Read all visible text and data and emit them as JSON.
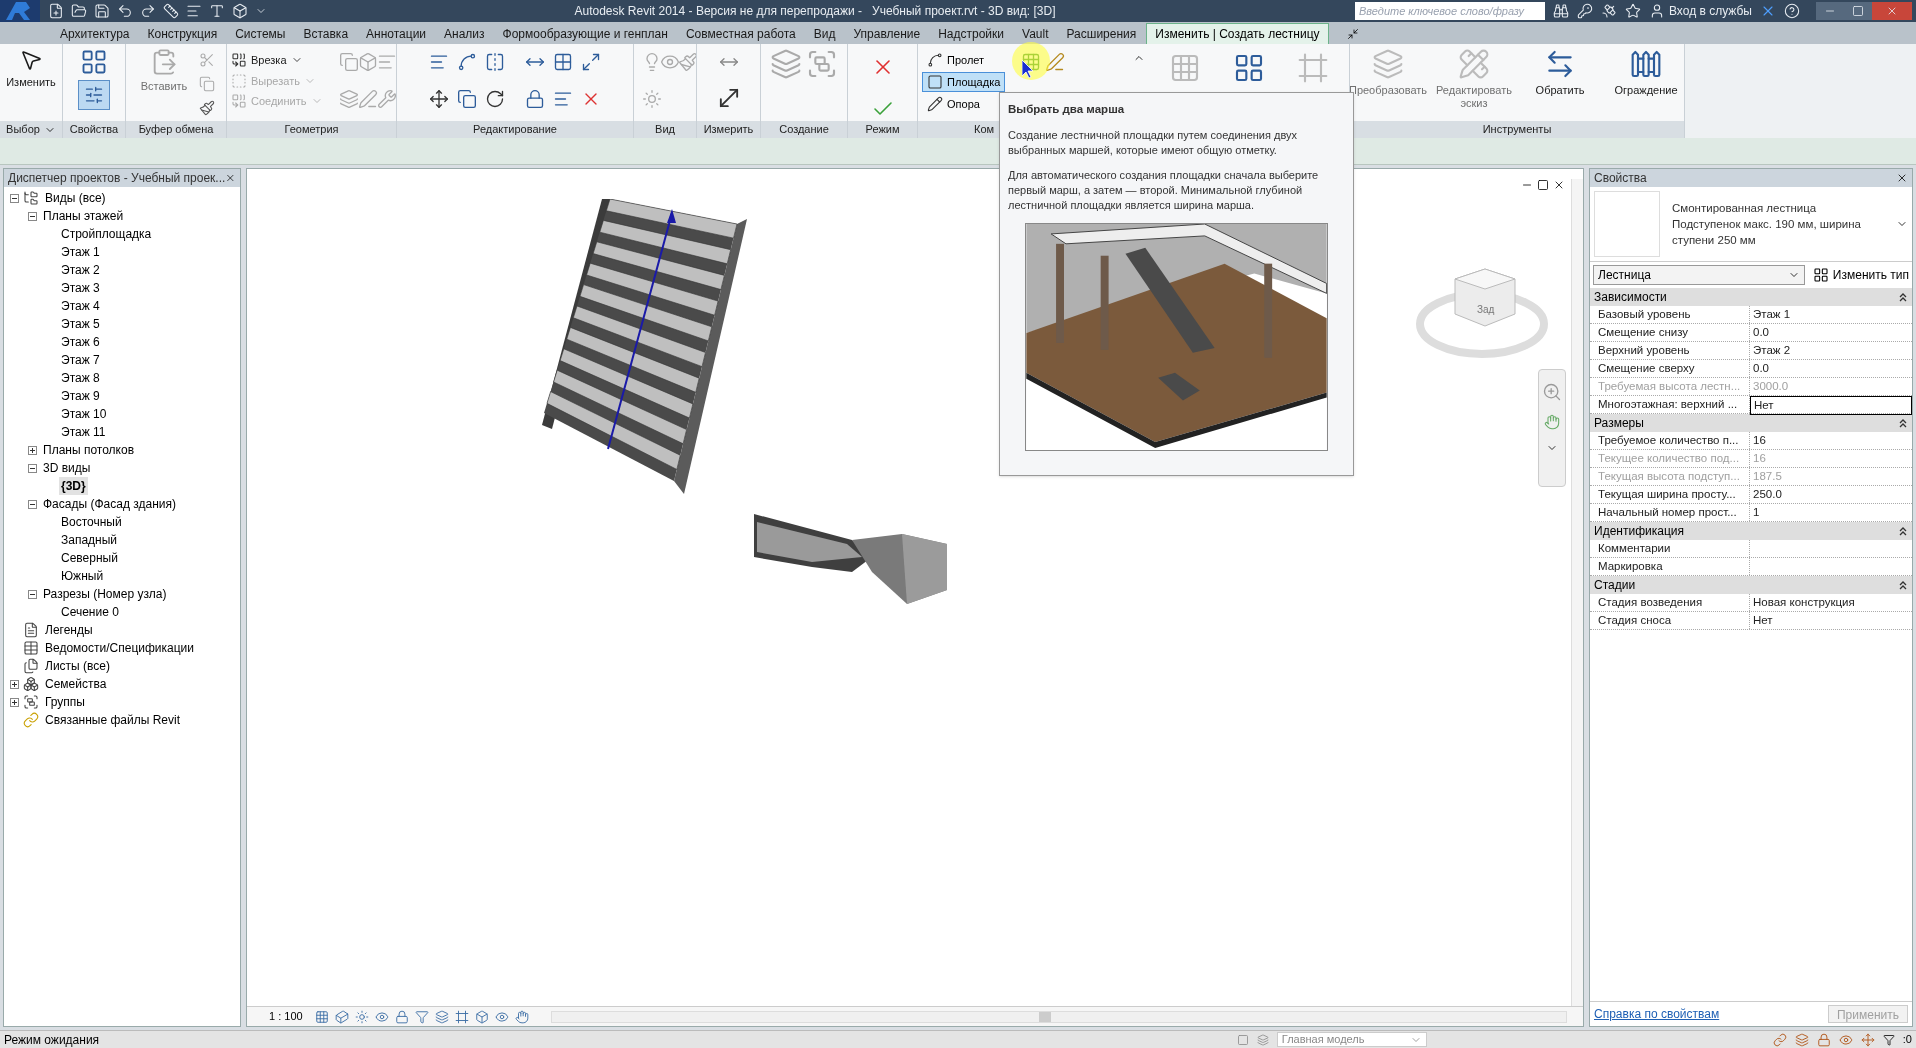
{
  "title_bar": {
    "title": "Autodesk Revit 2014 - Версия не для перепродажи -   Учебный проект.rvt - 3D вид: [3D]",
    "search": {
      "placeholder": "Введите ключевое слово/фразу"
    },
    "sign_in": "Вход в службы"
  },
  "tabs": [
    {
      "label": "Архитектура",
      "selected": false
    },
    {
      "label": "Конструкция",
      "selected": false
    },
    {
      "label": "Системы",
      "selected": false
    },
    {
      "label": "Вставка",
      "selected": false
    },
    {
      "label": "Аннотации",
      "selected": false
    },
    {
      "label": "Анализ",
      "selected": false
    },
    {
      "label": "Формообразующие и генплан",
      "selected": false
    },
    {
      "label": "Совместная работа",
      "selected": false
    },
    {
      "label": "Вид",
      "selected": false
    },
    {
      "label": "Управление",
      "selected": false
    },
    {
      "label": "Надстройки",
      "selected": false
    },
    {
      "label": "Vault",
      "selected": false
    },
    {
      "label": "Расширения",
      "selected": false
    },
    {
      "label": "Изменить | Создать лестницу",
      "selected": true
    }
  ],
  "ribbon": {
    "panels": [
      {
        "kind": "select",
        "title": "Выбор",
        "menu": true,
        "tools": [
          {
            "label": "Изменить",
            "disabled": false
          }
        ]
      },
      {
        "kind": "properties",
        "title": "Свойства",
        "menu": false
      },
      {
        "kind": "clipboard",
        "title": "Буфер обмена",
        "menu": false,
        "tools": [
          {
            "label": "Вставить",
            "disabled": true
          }
        ]
      },
      {
        "kind": "geometry",
        "title": "Геометрия",
        "menu": false,
        "tools": [
          {
            "label": "Врезка",
            "disabled": false
          },
          {
            "label": "Вырезать",
            "disabled": true
          },
          {
            "label": "Соединить",
            "disabled": true
          }
        ]
      },
      {
        "kind": "modify",
        "title": "Редактирование",
        "menu": false
      },
      {
        "kind": "view",
        "title": "Вид",
        "menu": false
      },
      {
        "kind": "measure",
        "title": "Измерить",
        "menu": false
      },
      {
        "kind": "create",
        "title": "Создание",
        "menu": false
      },
      {
        "kind": "mode",
        "title": "Режим",
        "menu": false
      },
      {
        "kind": "components",
        "title": "Ком",
        "menu": false,
        "tools": [
          {
            "label": "Пролет",
            "selected": false
          },
          {
            "label": "Площадка",
            "selected": true
          },
          {
            "label": "Опора",
            "selected": false
          }
        ]
      },
      {
        "kind": "tools",
        "title": "Инструменты",
        "menu": false,
        "tools": [
          {
            "label": "Преобразовать",
            "disabled": true
          },
          {
            "label": "Редактировать эскиз",
            "disabled": true
          },
          {
            "label": "Обратить",
            "disabled": false
          },
          {
            "label": "Ограждение",
            "disabled": false
          }
        ]
      }
    ]
  },
  "tooltip": {
    "title": "Выбрать два марша",
    "paragraphs": [
      "Создание лестничной площадки путем соединения двух выбранных маршей, которые имеют общую отметку.",
      "Для автоматического создания площадки сначала выберите первый марш, а затем — второй. Минимальной глубиной лестничной площадки является ширина марша."
    ]
  },
  "project_browser": {
    "title": "Диспетчер проектов - Учебный проек...",
    "tree": [
      {
        "kind": "views",
        "label": "Виды (все)",
        "expanded": true,
        "selected": false,
        "children": [
          {
            "label": "Планы этажей",
            "expanded": true,
            "selected": false,
            "children": [
              {
                "label": "Стройплощадка",
                "selected": false
              },
              {
                "label": "Этаж 1",
                "selected": false
              },
              {
                "label": "Этаж 2",
                "selected": false
              },
              {
                "label": "Этаж 3",
                "selected": false
              },
              {
                "label": "Этаж 4",
                "selected": false
              },
              {
                "label": "Этаж 5",
                "selected": false
              },
              {
                "label": "Этаж 6",
                "selected": false
              },
              {
                "label": "Этаж 7",
                "selected": false
              },
              {
                "label": "Этаж 8",
                "selected": false
              },
              {
                "label": "Этаж 9",
                "selected": false
              },
              {
                "label": "Этаж 10",
                "selected": false
              },
              {
                "label": "Этаж 11",
                "selected": false
              }
            ]
          },
          {
            "label": "Планы потолков",
            "expanded": false,
            "selected": false
          },
          {
            "label": "3D виды",
            "expanded": true,
            "selected": false,
            "children": [
              {
                "label": "{3D}",
                "selected": true
              }
            ]
          },
          {
            "label": "Фасады (Фасад здания)",
            "expanded": true,
            "selected": false,
            "children": [
              {
                "label": "Восточный",
                "selected": false
              },
              {
                "label": "Западный",
                "selected": false
              },
              {
                "label": "Северный",
                "selected": false
              },
              {
                "label": "Южный",
                "selected": false
              }
            ]
          },
          {
            "label": "Разрезы (Номер узла)",
            "expanded": true,
            "selected": false,
            "children": [
              {
                "label": "Сечение 0",
                "selected": false
              }
            ]
          }
        ]
      },
      {
        "kind": "legends",
        "label": "Легенды",
        "selected": false
      },
      {
        "kind": "schedules",
        "label": "Ведомости/Спецификации",
        "selected": false
      },
      {
        "kind": "sheets",
        "label": "Листы (все)",
        "selected": false
      },
      {
        "kind": "families",
        "label": "Семейства",
        "expanded": false,
        "selected": false
      },
      {
        "kind": "groups",
        "label": "Группы",
        "expanded": false,
        "selected": false
      },
      {
        "kind": "links",
        "label": "Связанные файлы Revit",
        "selected": false
      }
    ]
  },
  "view": {
    "scale": "1 : 100",
    "view_cube": {
      "face": "Зад"
    }
  },
  "properties": {
    "title": "Свойства",
    "type": {
      "family": "Смонтированная лестница",
      "name": "Подступенок макс. 190 мм, ширина ступени 250 мм"
    },
    "category": "Лестница",
    "edit_type": "Изменить тип",
    "groups": [
      {
        "title": "Зависимости",
        "expanded": true,
        "rows": [
          {
            "label": "Базовый уровень",
            "value": "Этаж 1",
            "disabled": false,
            "active": false
          },
          {
            "label": "Смещение снизу",
            "value": "0.0",
            "disabled": false,
            "active": false
          },
          {
            "label": "Верхний уровень",
            "value": "Этаж 2",
            "disabled": false,
            "active": false
          },
          {
            "label": "Смещение сверху",
            "value": "0.0",
            "disabled": false,
            "active": false
          },
          {
            "label": "Требуемая высота лестн...",
            "value": "3000.0",
            "disabled": true,
            "active": false
          },
          {
            "label": "Многоэтажная: верхний ...",
            "value": "Нет",
            "disabled": false,
            "active": true
          }
        ]
      },
      {
        "title": "Размеры",
        "expanded": true,
        "rows": [
          {
            "label": "Требуемое количество п...",
            "value": "16",
            "disabled": false,
            "active": false
          },
          {
            "label": "Текущее количество под...",
            "value": "16",
            "disabled": true,
            "active": false
          },
          {
            "label": "Текущая высота подступ...",
            "value": "187.5",
            "disabled": true,
            "active": false
          },
          {
            "label": "Текущая ширина просту...",
            "value": "250.0",
            "disabled": false,
            "active": false
          },
          {
            "label": "Начальный номер прост...",
            "value": "1",
            "disabled": false,
            "active": false
          }
        ]
      },
      {
        "title": "Идентификация",
        "expanded": true,
        "rows": [
          {
            "label": "Комментарии",
            "disabled": false,
            "active": false
          },
          {
            "label": "Маркировка",
            "disabled": false,
            "active": false
          }
        ]
      },
      {
        "title": "Стадии",
        "expanded": true,
        "rows": [
          {
            "label": "Стадия возведения",
            "value": "Новая конструкция",
            "disabled": false,
            "active": false
          },
          {
            "label": "Стадия сноса",
            "value": "Нет",
            "disabled": false,
            "active": false
          }
        ]
      }
    ],
    "help_link": "Справка по свойствам",
    "apply": {
      "label": "Применить",
      "disabled": true
    }
  },
  "status_bar": {
    "message": "Режим ожидания",
    "model": "Главная модель",
    "filter_count": ":0"
  }
}
